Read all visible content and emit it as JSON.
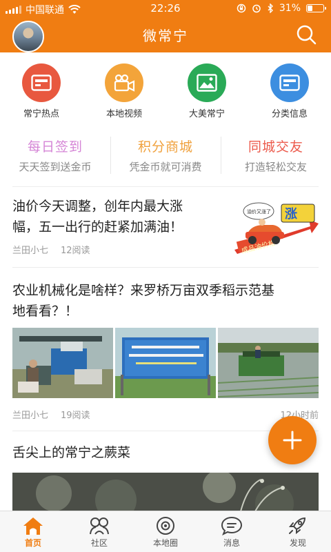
{
  "status_bar": {
    "carrier": "中国联通",
    "time": "22:26",
    "battery": "31%",
    "battery_level": 0.31
  },
  "header": {
    "title": "微常宁"
  },
  "quick_nav": [
    {
      "label": "常宁热点",
      "icon": "card-icon",
      "color": "#e8583f"
    },
    {
      "label": "本地视频",
      "icon": "video-camera-icon",
      "color": "#f3a43a"
    },
    {
      "label": "大美常宁",
      "icon": "picture-icon",
      "color": "#2aaa57"
    },
    {
      "label": "分类信息",
      "icon": "card-icon",
      "color": "#3c8ee0"
    }
  ],
  "features": [
    {
      "title": "每日签到",
      "subtitle": "天天签到送金币",
      "color": "#d585d6"
    },
    {
      "title": "积分商城",
      "subtitle": "凭金币就可消费",
      "color": "#f0a13d"
    },
    {
      "title": "同城交友",
      "subtitle": "打造轻松交友",
      "color": "#ec5a4c"
    }
  ],
  "articles": [
    {
      "title_line1": "油价今天调整，创年内最大涨",
      "title_line2": "幅，五一出行的赶紧加满油！",
      "author": "兰田小七",
      "reads": "12阅读",
      "thumb_text_1": "涨",
      "thumb_text_2": "成品油价格",
      "thumb_text_3": "油价又涨了"
    },
    {
      "title_line1": "农业机械化是啥样？来罗桥万亩双季稻示范基",
      "title_line2": "地看看？！",
      "author": "兰田小七",
      "reads": "19阅读",
      "time": "12小时前"
    },
    {
      "title_line1": "舌尖上的常宁之蕨菜"
    }
  ],
  "fab": {
    "icon": "plus-icon"
  },
  "tabbar": [
    {
      "label": "首页",
      "icon": "home-icon",
      "active": true
    },
    {
      "label": "社区",
      "icon": "community-icon",
      "active": false
    },
    {
      "label": "本地圈",
      "icon": "local-circle-icon",
      "active": false
    },
    {
      "label": "消息",
      "icon": "message-icon",
      "active": false
    },
    {
      "label": "发现",
      "icon": "rocket-icon",
      "active": false
    }
  ],
  "colors": {
    "brand": "#f07d12",
    "text": "#222222",
    "muted": "#999999"
  }
}
